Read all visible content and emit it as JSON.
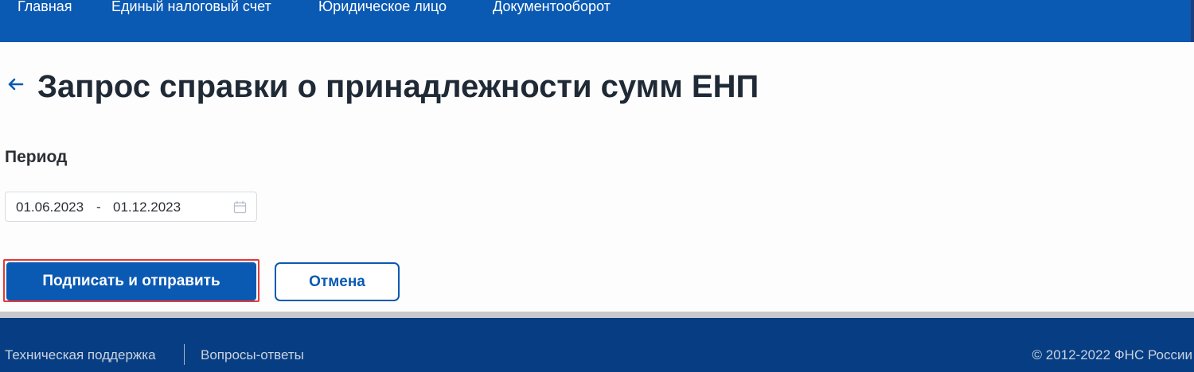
{
  "nav": {
    "items": [
      {
        "label": "Главная"
      },
      {
        "label": "Единый налоговый счет"
      },
      {
        "label": "Юридическое лицо"
      },
      {
        "label": "Документооборот"
      }
    ]
  },
  "page": {
    "back_icon": "arrow-left-icon",
    "title": "Запрос справки о принадлежности сумм ЕНП"
  },
  "form": {
    "period_label": "Период",
    "date_from": "01.06.2023",
    "separator": "-",
    "date_to": "01.12.2023",
    "calendar_icon": "calendar-icon"
  },
  "actions": {
    "submit_label": "Подписать и отправить",
    "cancel_label": "Отмена"
  },
  "footer": {
    "support_link": "Техническая поддержка",
    "faq_link": "Вопросы-ответы",
    "copyright": "© 2012-2022 ФНС России"
  },
  "colors": {
    "brand_blue": "#0a59b3",
    "footer_blue": "#073d82",
    "highlight_red": "#e23a3a"
  }
}
